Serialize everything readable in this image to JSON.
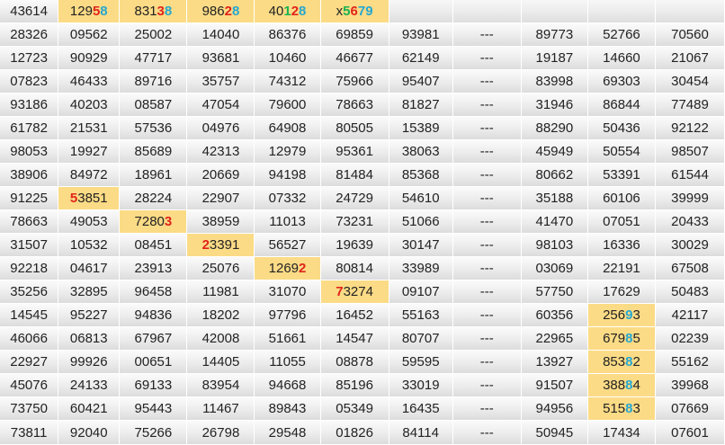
{
  "colors": {
    "highlight": "#fbdb86",
    "digit_red": "#e0241b",
    "digit_blue": "#26a7cf",
    "digit_green": "#18b24f"
  },
  "header": [
    {
      "segments": [
        {
          "t": "43614"
        }
      ]
    },
    {
      "hl": true,
      "segments": [
        {
          "t": "129"
        },
        {
          "t": "5",
          "c": "red"
        },
        {
          "t": "8",
          "c": "blue"
        }
      ]
    },
    {
      "hl": true,
      "segments": [
        {
          "t": "831"
        },
        {
          "t": "3",
          "c": "red"
        },
        {
          "t": "8",
          "c": "blue"
        }
      ]
    },
    {
      "hl": true,
      "segments": [
        {
          "t": "986"
        },
        {
          "t": "2",
          "c": "red"
        },
        {
          "t": "8",
          "c": "blue"
        }
      ]
    },
    {
      "hl": true,
      "segments": [
        {
          "t": "40"
        },
        {
          "t": "1",
          "c": "green"
        },
        {
          "t": "2",
          "c": "red"
        },
        {
          "t": "8",
          "c": "blue"
        }
      ]
    },
    {
      "hl": true,
      "segments": [
        {
          "t": "x"
        },
        {
          "t": "5",
          "c": "green"
        },
        {
          "t": "6",
          "c": "red"
        },
        {
          "t": "7",
          "c": "blue"
        },
        {
          "t": "9",
          "c": "blue"
        }
      ]
    },
    {
      "blank": true,
      "segments": []
    },
    {
      "blank": true,
      "segments": []
    },
    {
      "blank": true,
      "segments": []
    },
    {
      "blank": true,
      "segments": []
    },
    {
      "blank": true,
      "segments": []
    }
  ],
  "rows": [
    [
      "28326",
      "09562",
      "25002",
      "14040",
      "86376",
      "69859",
      "93981",
      "---",
      "89773",
      "52766",
      "70560"
    ],
    [
      "12723",
      "90929",
      "47717",
      "93681",
      "10460",
      "46677",
      "62149",
      "---",
      "19187",
      "14660",
      "21067"
    ],
    [
      "07823",
      "46433",
      "89716",
      "35757",
      "74312",
      "75966",
      "95407",
      "---",
      "83998",
      "69303",
      "30454"
    ],
    [
      "93186",
      "40203",
      "08587",
      "47054",
      "79600",
      "78663",
      "81827",
      "---",
      "31946",
      "86844",
      "77489"
    ],
    [
      "61782",
      "21531",
      "57536",
      "04976",
      "64908",
      "80505",
      "15389",
      "---",
      "88290",
      "50436",
      "92122"
    ],
    [
      "98053",
      "19927",
      "85689",
      "42313",
      "12979",
      "95361",
      "38063",
      "---",
      "45949",
      "50554",
      "98507"
    ],
    [
      "38906",
      "84972",
      "18961",
      "20669",
      "94198",
      "81484",
      "85368",
      "---",
      "80662",
      "53391",
      "61544"
    ],
    [
      "91225",
      {
        "hl": true,
        "segments": [
          {
            "t": "5",
            "c": "red"
          },
          {
            "t": "3851"
          }
        ]
      },
      "28224",
      "22907",
      "07332",
      "24729",
      "54610",
      "---",
      "35188",
      "60106",
      "39999"
    ],
    [
      "78663",
      "49053",
      {
        "hl": true,
        "segments": [
          {
            "t": "7280"
          },
          {
            "t": "3",
            "c": "red"
          }
        ]
      },
      "38959",
      "11013",
      "73231",
      "51066",
      "---",
      "41470",
      "07051",
      "20433"
    ],
    [
      "31507",
      "10532",
      "08451",
      {
        "hl": true,
        "segments": [
          {
            "t": "2",
            "c": "red"
          },
          {
            "t": "3391"
          }
        ]
      },
      "56527",
      "19639",
      "30147",
      "---",
      "98103",
      "16336",
      "30029"
    ],
    [
      "92218",
      "04617",
      "23913",
      "25076",
      {
        "hl": true,
        "segments": [
          {
            "t": "1269"
          },
          {
            "t": "2",
            "c": "red"
          }
        ]
      },
      "80814",
      "33989",
      "---",
      "03069",
      "22191",
      "67508"
    ],
    [
      "35256",
      "32895",
      "96458",
      "11981",
      "31070",
      {
        "hl": true,
        "segments": [
          {
            "t": "7",
            "c": "red"
          },
          {
            "t": "3274"
          }
        ]
      },
      "09107",
      "---",
      "57750",
      "17629",
      "50483"
    ],
    [
      "14545",
      "95227",
      "94836",
      "18202",
      "97796",
      "16452",
      "55163",
      "---",
      "60356",
      {
        "hl": true,
        "segments": [
          {
            "t": "256"
          },
          {
            "t": "9",
            "c": "blue"
          },
          {
            "t": "3"
          }
        ]
      },
      "42117"
    ],
    [
      "46066",
      "06813",
      "67967",
      "42008",
      "51661",
      "14547",
      "80707",
      "---",
      "22965",
      {
        "hl": true,
        "segments": [
          {
            "t": "679"
          },
          {
            "t": "8",
            "c": "blue"
          },
          {
            "t": "5"
          }
        ]
      },
      "02239"
    ],
    [
      "22927",
      "99926",
      "00651",
      "14405",
      "11055",
      "08878",
      "59595",
      "---",
      "13927",
      {
        "hl": true,
        "segments": [
          {
            "t": "853"
          },
          {
            "t": "8",
            "c": "blue"
          },
          {
            "t": "2"
          }
        ]
      },
      "55162"
    ],
    [
      "45076",
      "24133",
      "69133",
      "83954",
      "94668",
      "85196",
      "33019",
      "---",
      "91507",
      {
        "hl": true,
        "segments": [
          {
            "t": "388"
          },
          {
            "t": "8",
            "c": "blue"
          },
          {
            "t": "4"
          }
        ]
      },
      "39968"
    ],
    [
      "73750",
      "60421",
      "95443",
      "11467",
      "89843",
      "05349",
      "16435",
      "---",
      "94956",
      {
        "hl": true,
        "segments": [
          {
            "t": "515"
          },
          {
            "t": "8",
            "c": "blue"
          },
          {
            "t": "3"
          }
        ]
      },
      "07669"
    ],
    [
      "73811",
      "92040",
      "75266",
      "26798",
      "29548",
      "01826",
      "84114",
      "---",
      "50945",
      "17434",
      "07601"
    ]
  ]
}
